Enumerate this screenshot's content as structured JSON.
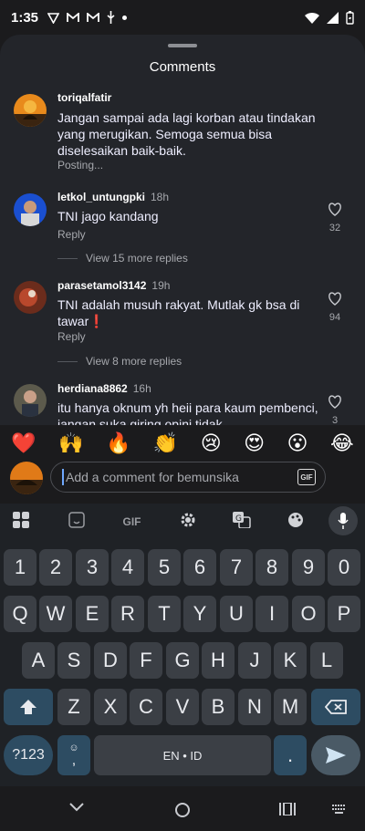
{
  "status": {
    "time": "1:35",
    "notif_icons": [
      "vpn-icon",
      "gmail-icon",
      "gmail-icon",
      "usb-icon",
      "dot-icon"
    ]
  },
  "sheet": {
    "title": "Comments"
  },
  "comments": [
    {
      "username": "toriqalfatir",
      "time": "",
      "text": "Jangan sampai ada lagi korban atau tindakan yang merugikan. Semoga semua bisa diselesaikan baik-baik.",
      "reply": "Posting...",
      "likes": ""
    },
    {
      "username": "letkol_untungpki",
      "time": "18h",
      "text": "TNI jago kandang",
      "reply": "Reply",
      "likes": "32",
      "more": "View 15 more replies"
    },
    {
      "username": "parasetamol3142",
      "time": "19h",
      "text": "TNI adalah musuh rakyat. Mutlak gk bsa di tawar❗",
      "reply": "Reply",
      "likes": "94",
      "more": "View 8 more replies"
    },
    {
      "username": "herdiana8862",
      "time": "16h",
      "text": "itu hanya oknum yh heii para kaum pembenci, jangan suka giring opini tidak",
      "reply": "",
      "likes": "3"
    }
  ],
  "emojis": [
    "❤️",
    "🙌",
    "🔥",
    "👏",
    "😢",
    "😍",
    "😮",
    "😂"
  ],
  "input": {
    "placeholder": "Add a comment for bemunsika",
    "gif": "GIF"
  },
  "keyboard": {
    "tools": {
      "gif": "GIF"
    },
    "row_numbers": [
      "1",
      "2",
      "3",
      "4",
      "5",
      "6",
      "7",
      "8",
      "9",
      "0"
    ],
    "row1": [
      "Q",
      "W",
      "E",
      "R",
      "T",
      "Y",
      "U",
      "I",
      "O",
      "P"
    ],
    "row2": [
      "A",
      "S",
      "D",
      "F",
      "G",
      "H",
      "J",
      "K",
      "L"
    ],
    "row3": [
      "Z",
      "X",
      "C",
      "V",
      "B",
      "N",
      "M"
    ],
    "symbols": "?123",
    "comma": ",",
    "space": "EN • ID",
    "period": "."
  },
  "colors": {
    "sheet": "#23252a",
    "accent": "#6fa8ff",
    "key": "#3b3f45",
    "action": "#2d4c62"
  }
}
